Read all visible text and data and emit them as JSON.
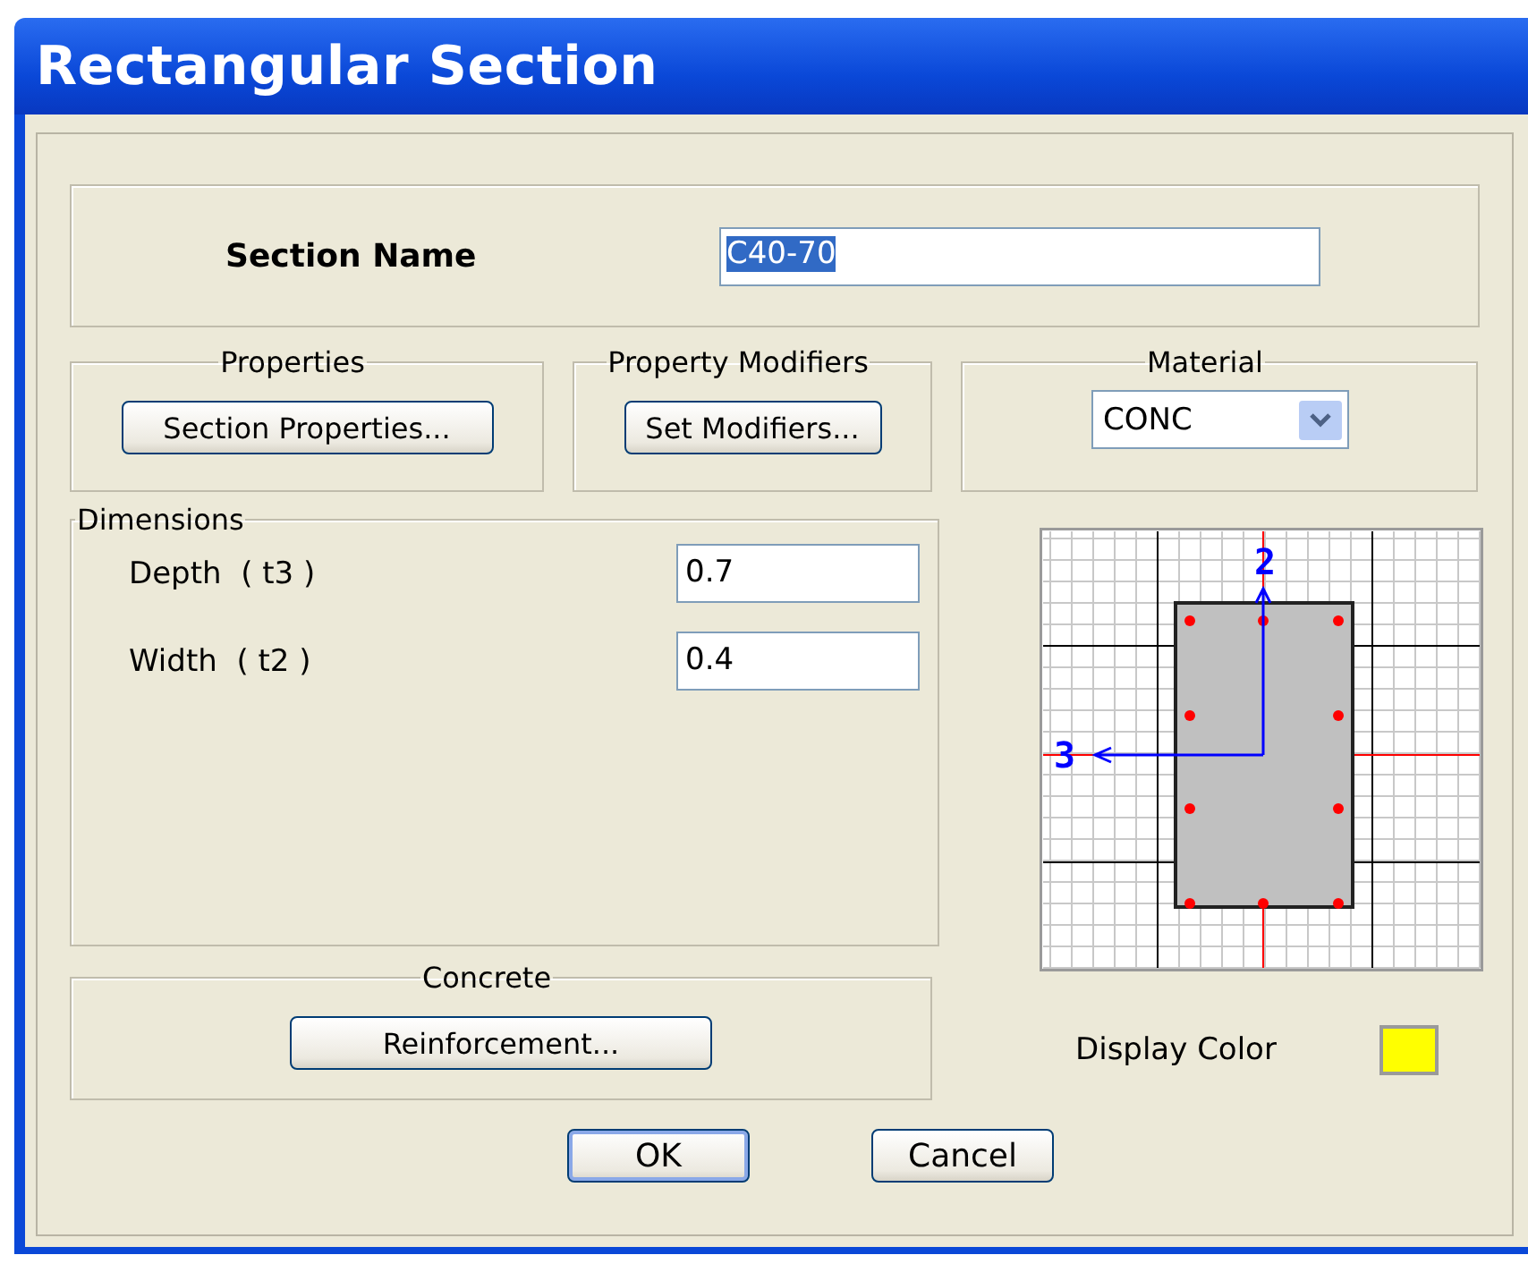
{
  "window": {
    "title": "Rectangular Section"
  },
  "section_name": {
    "label": "Section Name",
    "value": "C40-70",
    "text_selected": true
  },
  "properties": {
    "legend": "Properties",
    "button": "Section Properties..."
  },
  "property_modifiers": {
    "legend": "Property Modifiers",
    "button": "Set Modifiers..."
  },
  "material": {
    "legend": "Material",
    "value": "CONC"
  },
  "dimensions": {
    "legend": "Dimensions",
    "fields": [
      {
        "label": "Depth  ( t3 )",
        "value": "0.7"
      },
      {
        "label": "Width  ( t2 )",
        "value": "0.4"
      }
    ]
  },
  "section_diagram": {
    "axis_2": "2",
    "axis_3": "3"
  },
  "concrete": {
    "legend": "Concrete",
    "button": "Reinforcement..."
  },
  "display_color": {
    "label": "Display Color",
    "color": "#ffff00"
  },
  "buttons": [
    {
      "label": "OK",
      "default": true
    },
    {
      "label": "Cancel",
      "default": false
    }
  ]
}
